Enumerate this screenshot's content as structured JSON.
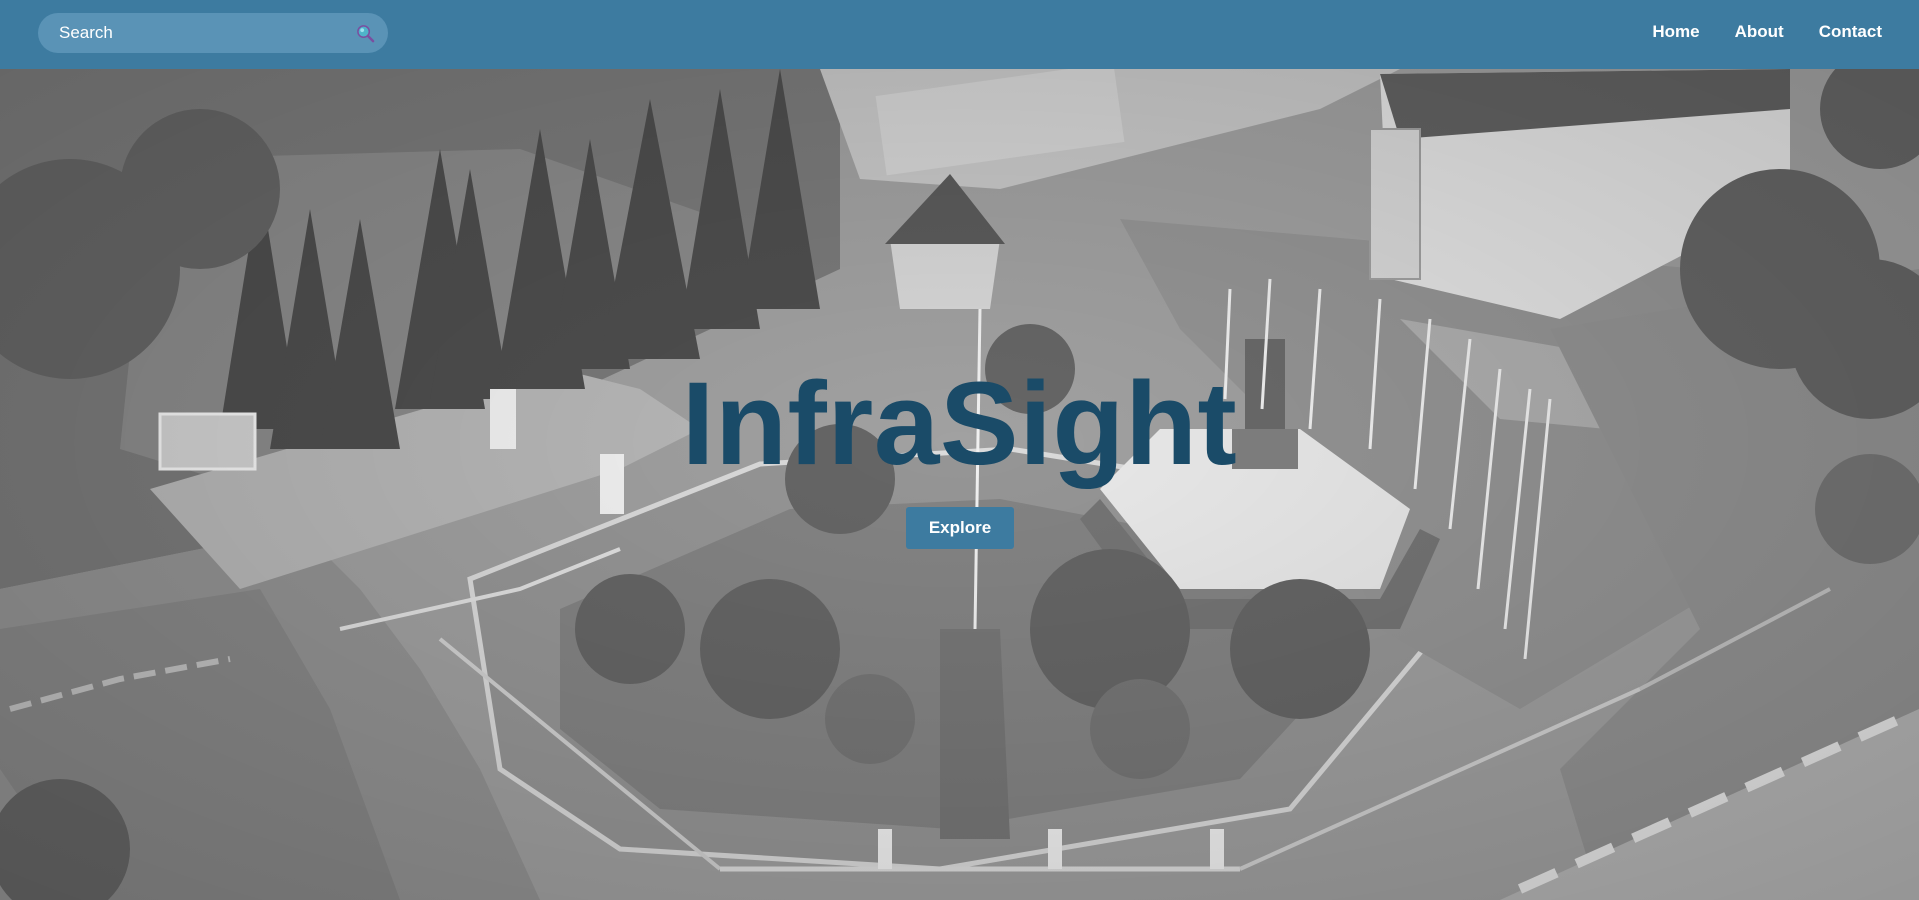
{
  "header": {
    "search": {
      "placeholder": "Search",
      "value": "",
      "icon": "search-icon"
    },
    "nav": [
      {
        "label": "Home"
      },
      {
        "label": "About"
      },
      {
        "label": "Contact"
      }
    ],
    "background_color": "#3d7ba0"
  },
  "hero": {
    "title": "InfraSight",
    "title_color": "#1a4b68",
    "button_label": "Explore",
    "button_color": "#3d7ba0",
    "background_image": "grayscale aerial photo of a campus plaza with flagpoles, a monument and pine trees"
  }
}
